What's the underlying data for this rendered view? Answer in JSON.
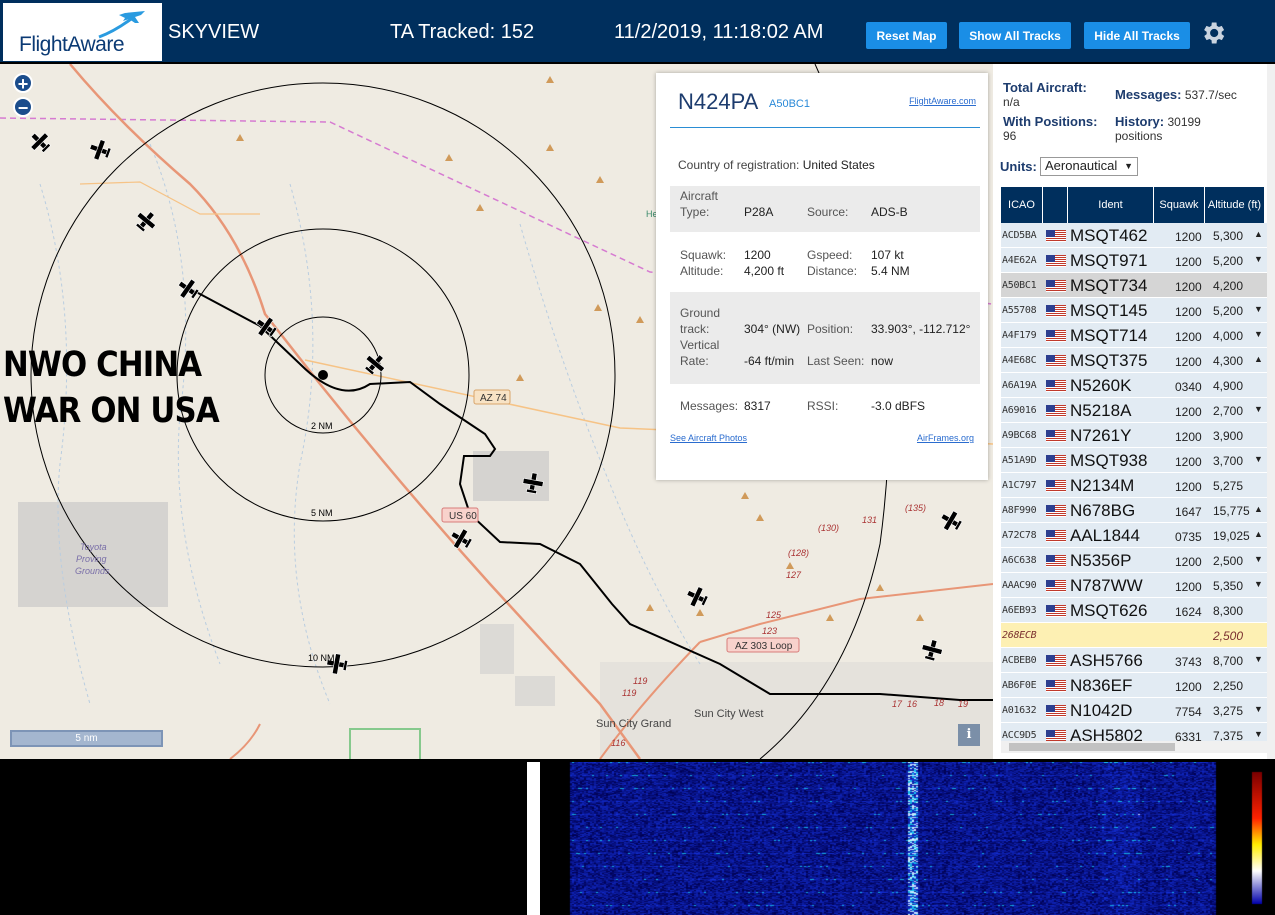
{
  "header": {
    "logo": "FlightAware",
    "app_name": "SKYVIEW",
    "tracked": "TA Tracked: 152",
    "datetime": "11/2/2019, 11:18:02 AM",
    "btn_reset": "Reset Map",
    "btn_show": "Show All Tracks",
    "btn_hide": "Hide All Tracks",
    "settings_icon": "gear-icon",
    "brand_color": "#002f5d",
    "button_color": "#1a8ee6"
  },
  "map": {
    "zoom_in": "+",
    "zoom_out": "−",
    "overlay_line1": "NWO CHINA",
    "overlay_line2": "WAR ON USA",
    "ring_2": "2 NM",
    "ring_5": "5 NM",
    "ring_10": "10 NM",
    "scale": "5 nm",
    "info": "i",
    "labels": {
      "az74": "AZ 74",
      "us60": "US 60",
      "az303": "AZ 303 Loop",
      "toyota": "Toyota Proving Grounds",
      "sun_city_grand": "Sun City Grand",
      "sun_city_west": "Sun City West",
      "he": "He",
      "r130": "(130)",
      "r131": "131",
      "r135": "(135)",
      "r128": "(128)",
      "r127": "127",
      "r125": "125",
      "r123": "123",
      "r119a": "119",
      "r119b": "119",
      "r116": "116",
      "r17": "17",
      "r16": "16",
      "r18": "18",
      "r19": "19"
    }
  },
  "popup": {
    "callsign": "N424PA",
    "hex": "A50BC1",
    "fa_link": "FlightAware.com",
    "country_label": "Country of registration:",
    "country_value": "United States",
    "type_label": "Aircraft Type:",
    "type_value": "P28A",
    "source_label": "Source:",
    "source_value": "ADS-B",
    "squawk_label": "Squawk:",
    "squawk_value": "1200",
    "altitude_label": "Altitude:",
    "altitude_value": "4,200 ft",
    "gspeed_label": "Gspeed:",
    "gspeed_value": "107 kt",
    "distance_label": "Distance:",
    "distance_value": "5.4 NM",
    "track_label": "Ground track:",
    "track_value": "304° (NW)",
    "position_label": "Position:",
    "position_value": "33.903°, -112.712°",
    "vrate_label": "Vertical Rate:",
    "vrate_value": "-64 ft/min",
    "lastseen_label": "Last Seen:",
    "lastseen_value": "now",
    "messages_label": "Messages:",
    "messages_value": "8317",
    "rssi_label": "RSSI:",
    "rssi_value": "-3.0 dBFS",
    "photos_link": "See Aircraft Photos",
    "airframes_link": "AirFrames.org"
  },
  "panel": {
    "total_label": "Total Aircraft:",
    "total_value": "n/a",
    "positions_label": "With Positions:",
    "positions_value": "96",
    "messages_label": "Messages:",
    "messages_value": "537.7/sec",
    "history_label": "History:",
    "history_value": "30199",
    "history_unit": "positions",
    "units_label": "Units:",
    "units_value": "Aeronautical",
    "columns": [
      "ICAO",
      "Ident",
      "Squawk",
      "Altitude (ft)"
    ],
    "rows": [
      {
        "icao": "ACD5BA",
        "flag": true,
        "ident": "MSQT462",
        "squawk": "1200",
        "alt": "5,300",
        "trend": "▲"
      },
      {
        "icao": "A4E62A",
        "flag": true,
        "ident": "MSQT971",
        "squawk": "1200",
        "alt": "5,200",
        "trend": "▼"
      },
      {
        "icao": "A50BC1",
        "flag": true,
        "ident": "MSQT734",
        "squawk": "1200",
        "alt": "4,200",
        "trend": ""
      },
      {
        "icao": "A55708",
        "flag": true,
        "ident": "MSQT145",
        "squawk": "1200",
        "alt": "5,200",
        "trend": "▼"
      },
      {
        "icao": "A4F179",
        "flag": true,
        "ident": "MSQT714",
        "squawk": "1200",
        "alt": "4,000",
        "trend": "▼"
      },
      {
        "icao": "A4E68C",
        "flag": true,
        "ident": "MSQT375",
        "squawk": "1200",
        "alt": "4,300",
        "trend": "▲"
      },
      {
        "icao": "A6A19A",
        "flag": true,
        "ident": "N5260K",
        "squawk": "0340",
        "alt": "4,900",
        "trend": ""
      },
      {
        "icao": "A69016",
        "flag": true,
        "ident": "N5218A",
        "squawk": "1200",
        "alt": "2,700",
        "trend": "▼"
      },
      {
        "icao": "A9BC68",
        "flag": true,
        "ident": "N7261Y",
        "squawk": "1200",
        "alt": "3,900",
        "trend": ""
      },
      {
        "icao": "A51A9D",
        "flag": true,
        "ident": "MSQT938",
        "squawk": "1200",
        "alt": "3,700",
        "trend": "▼"
      },
      {
        "icao": "A1C797",
        "flag": true,
        "ident": "N2134M",
        "squawk": "1200",
        "alt": "5,275",
        "trend": ""
      },
      {
        "icao": "A8F990",
        "flag": true,
        "ident": "N678BG",
        "squawk": "1647",
        "alt": "15,775",
        "trend": "▲"
      },
      {
        "icao": "A72C78",
        "flag": true,
        "ident": "AAL1844",
        "squawk": "0735",
        "alt": "19,025",
        "trend": "▲"
      },
      {
        "icao": "A6C638",
        "flag": true,
        "ident": "N5356P",
        "squawk": "1200",
        "alt": "2,500",
        "trend": "▼"
      },
      {
        "icao": "AAAC90",
        "flag": true,
        "ident": "N787WW",
        "squawk": "1200",
        "alt": "5,350",
        "trend": "▼"
      },
      {
        "icao": "A6EB93",
        "flag": true,
        "ident": "MSQT626",
        "squawk": "1624",
        "alt": "8,300",
        "trend": ""
      },
      {
        "icao": "268ECB",
        "flag": false,
        "ident": "",
        "squawk": "",
        "alt": "2,500",
        "trend": ""
      },
      {
        "icao": "ACBEB0",
        "flag": true,
        "ident": "ASH5766",
        "squawk": "3743",
        "alt": "8,700",
        "trend": "▼"
      },
      {
        "icao": "AB6F0E",
        "flag": true,
        "ident": "N836EF",
        "squawk": "1200",
        "alt": "2,250",
        "trend": ""
      },
      {
        "icao": "A01632",
        "flag": true,
        "ident": "N1042D",
        "squawk": "7754",
        "alt": "3,275",
        "trend": "▼"
      },
      {
        "icao": "ACC9D5",
        "flag": true,
        "ident": "ASH5802",
        "squawk": "6331",
        "alt": "7,375",
        "trend": "▼"
      }
    ]
  }
}
